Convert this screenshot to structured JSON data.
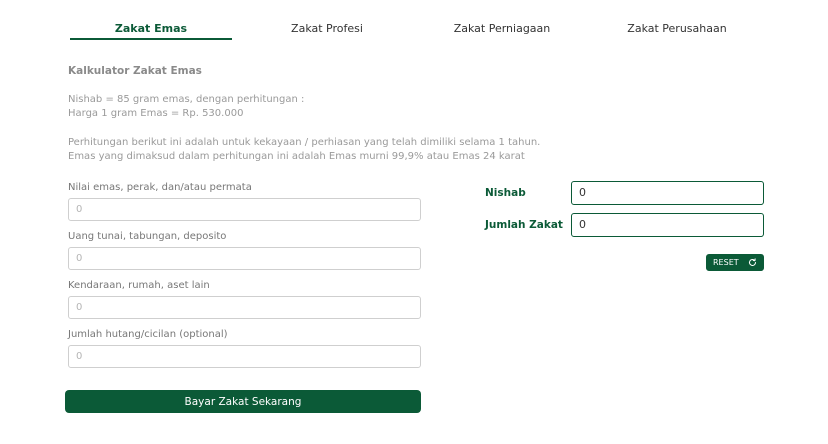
{
  "tabs": [
    {
      "label": "Zakat Emas",
      "active": true
    },
    {
      "label": "Zakat Profesi",
      "active": false
    },
    {
      "label": "Zakat Perniagaan",
      "active": false
    },
    {
      "label": "Zakat Perusahaan",
      "active": false
    }
  ],
  "calculator": {
    "title": "Kalkulator Zakat Emas",
    "info_lines": [
      "Nishab = 85 gram emas, dengan perhitungan :",
      "Harga 1 gram Emas = Rp. 530.000",
      "Perhitungan berikut ini adalah untuk kekayaan / perhiasan yang telah dimiliki selama 1 tahun.",
      "Emas yang dimaksud dalam perhitungan ini adalah Emas murni 99,9% atau Emas 24 karat"
    ],
    "fields": [
      {
        "label": "Nilai emas, perak, dan/atau permata",
        "placeholder": "0"
      },
      {
        "label": "Uang tunai, tabungan, deposito",
        "placeholder": "0"
      },
      {
        "label": "Kendaraan, rumah, aset lain",
        "placeholder": "0"
      },
      {
        "label": "Jumlah hutang/cicilan (optional)",
        "placeholder": "0"
      }
    ],
    "pay_button_label": "Bayar Zakat Sekarang"
  },
  "results": {
    "nishab_label": "Nishab",
    "nishab_value": "0",
    "zakat_label": "Jumlah Zakat",
    "zakat_value": "0",
    "reset_label": "RESET",
    "reset_icon": "refresh-icon"
  },
  "colors": {
    "accent": "#0b5a37",
    "muted_text": "#9a9a9a",
    "border": "#cfcfcf"
  }
}
